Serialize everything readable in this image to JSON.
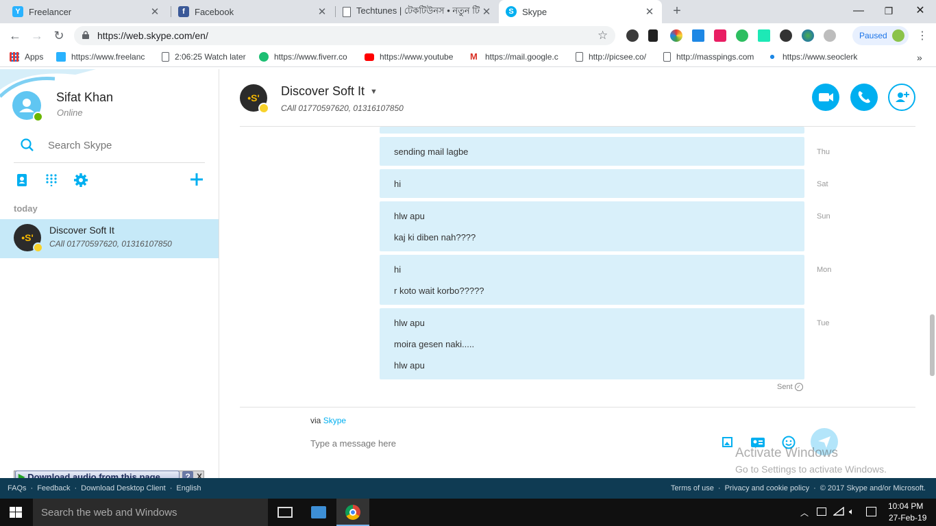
{
  "browser": {
    "tabs": [
      {
        "title": "Freelancer",
        "icon": "freelancer-icon",
        "color": "#29b2fe"
      },
      {
        "title": "Facebook",
        "icon": "facebook-icon",
        "color": "#3b5998"
      },
      {
        "title": "Techtunes | টেকটিউনস • নতুন টি",
        "icon": "page-icon",
        "color": "#ffffff"
      },
      {
        "title": "Skype",
        "icon": "skype-icon",
        "color": "#00aff0"
      }
    ],
    "new_tab": "+",
    "url": "https://web.skype.com/en/",
    "paused_label": "Paused",
    "bookmarks": [
      {
        "label": "Apps"
      },
      {
        "label": "https://www.freelanc"
      },
      {
        "label": "2:06:25 Watch later"
      },
      {
        "label": "https://www.fiverr.co"
      },
      {
        "label": "https://www.youtube"
      },
      {
        "label": "https://mail.google.c"
      },
      {
        "label": "http://picsee.co/"
      },
      {
        "label": "http://masspings.com"
      },
      {
        "label": "https://www.seoclerk"
      }
    ]
  },
  "profile": {
    "name": "Sifat Khan",
    "status": "Online"
  },
  "search": {
    "placeholder": "Search Skype"
  },
  "recents": {
    "section_label": "today",
    "items": [
      {
        "name": "Discover Soft It",
        "subtitle": "CAll 01770597620, 01316107850"
      }
    ]
  },
  "conversation": {
    "title": "Discover Soft It",
    "subtitle": "CAll 01770597620, 01316107850",
    "messages": [
      {
        "day": "Thu",
        "lines": [
          "sending mail lagbe"
        ]
      },
      {
        "day": "Sat",
        "lines": [
          "hi"
        ]
      },
      {
        "day": "Sun",
        "lines": [
          "hlw apu",
          "kaj ki diben nah????"
        ]
      },
      {
        "day": "Mon",
        "lines": [
          "hi",
          "r koto wait korbo?????"
        ]
      },
      {
        "day": "Tue",
        "lines": [
          "hlw apu",
          "moira gesen naki.....",
          "hlw apu"
        ]
      }
    ],
    "sent_label": "Sent",
    "via_prefix": "via",
    "via_link": "Skype",
    "compose_placeholder": "Type a message here"
  },
  "watermark": {
    "title": "Activate Windows",
    "subtitle": "Go to Settings to activate Windows."
  },
  "download_bar": {
    "label": "Download audio from this page",
    "help": "?",
    "close": "X"
  },
  "footer": {
    "left": [
      "FAQs",
      "Feedback",
      "Download Desktop Client",
      "English"
    ],
    "right": [
      "Terms of use",
      "Privacy and cookie policy",
      "© 2017 Skype and/or Microsoft."
    ]
  },
  "taskbar": {
    "search_placeholder": "Search the web and Windows",
    "time": "10:04 PM",
    "date": "27-Feb-19"
  },
  "colors": {
    "skype_blue": "#00aff0",
    "message_bg": "#d9f0fa",
    "selected_bg": "#c6e9f8",
    "footer_bg": "#0f3b53"
  }
}
